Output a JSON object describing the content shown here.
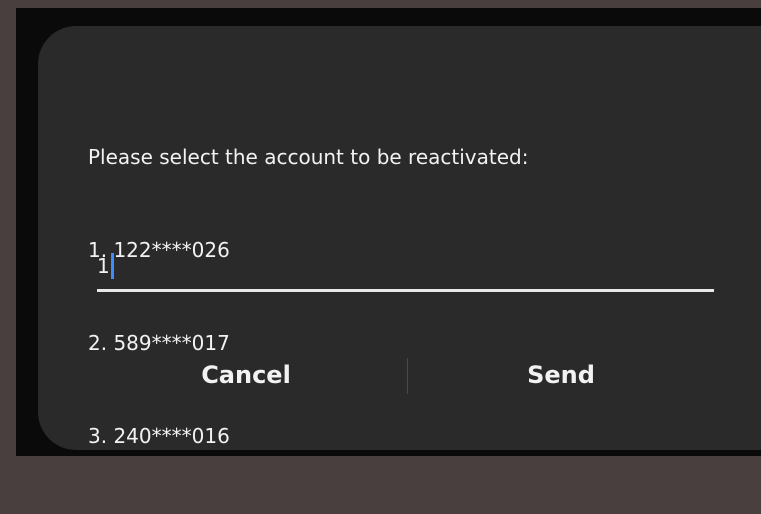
{
  "dialog": {
    "prompt": "Please select the account to be reactivated:",
    "accounts": [
      "1. 122****026",
      "2. 589****017",
      "3. 240****016"
    ],
    "input_value": "1",
    "cancel_label": "Cancel",
    "send_label": "Send"
  },
  "colors": {
    "dialog_bg": "#2a2a2a",
    "text": "#f2f2f2",
    "caret": "#3d8cff"
  }
}
